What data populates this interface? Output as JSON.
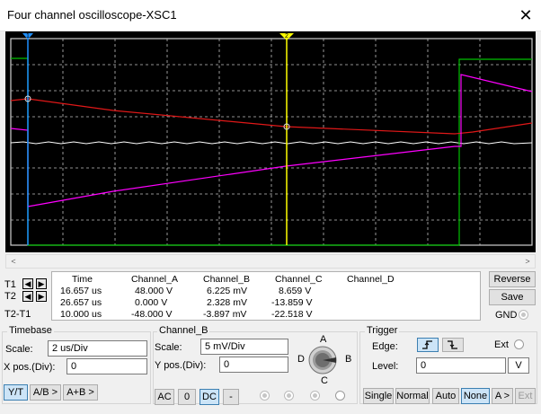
{
  "window": {
    "title": "Four channel oscilloscope-XSC1",
    "close_glyph": "✕"
  },
  "cursors": {
    "t1_label": "T1",
    "t2_label": "T2",
    "diff_label": "T2-T1",
    "left_arrow": "◀",
    "right_arrow": "▶",
    "t1_marker": "1",
    "t2_marker": "2"
  },
  "readouts": {
    "headers": [
      "Time",
      "Channel_A",
      "Channel_B",
      "Channel_C",
      "Channel_D"
    ],
    "rows": [
      [
        "16.657 us",
        "48.000 V",
        "6.225 mV",
        "8.659 V",
        ""
      ],
      [
        "26.657 us",
        "0.000 V",
        "2.328 mV",
        "-13.859 V",
        ""
      ],
      [
        "10.000 us",
        "-48.000 V",
        "-3.897 mV",
        "-22.518 V",
        ""
      ]
    ]
  },
  "side_buttons": {
    "reverse": "Reverse",
    "save": "Save",
    "gnd": "GND"
  },
  "timebase": {
    "title": "Timebase",
    "scale_label": "Scale:",
    "scale_value": "2 us/Div",
    "xpos_label": "X pos.(Div):",
    "xpos_value": "0",
    "modes": [
      "Y/T",
      "A/B >",
      "A+B >"
    ],
    "active_mode": "Y/T"
  },
  "channel": {
    "title": "Channel_B",
    "scale_label": "Scale:",
    "scale_value": "5 mV/Div",
    "ypos_label": "Y pos.(Div):",
    "ypos_value": "0",
    "coupling": [
      "AC",
      "0",
      "DC",
      "-"
    ],
    "active_coupling": "DC",
    "knob": {
      "a": "A",
      "b": "B",
      "c": "C",
      "d": "D"
    }
  },
  "trigger": {
    "title": "Trigger",
    "edge_label": "Edge:",
    "ext_label": "Ext",
    "level_label": "Level:",
    "level_value": "0",
    "level_unit": "V",
    "modes": [
      "Single",
      "Normal",
      "Auto",
      "None",
      "A >",
      "Ext"
    ],
    "active_mode": "None"
  },
  "colors": {
    "screen_bg": "#000000",
    "grid": "#bfbfbf",
    "channel_a": "#00c000",
    "channel_b": "#ffffff",
    "channel_c": "#ff00ff",
    "channel_d": "#e01818",
    "cursor_1": "#1e90ff",
    "cursor_2": "#ffff00"
  }
}
